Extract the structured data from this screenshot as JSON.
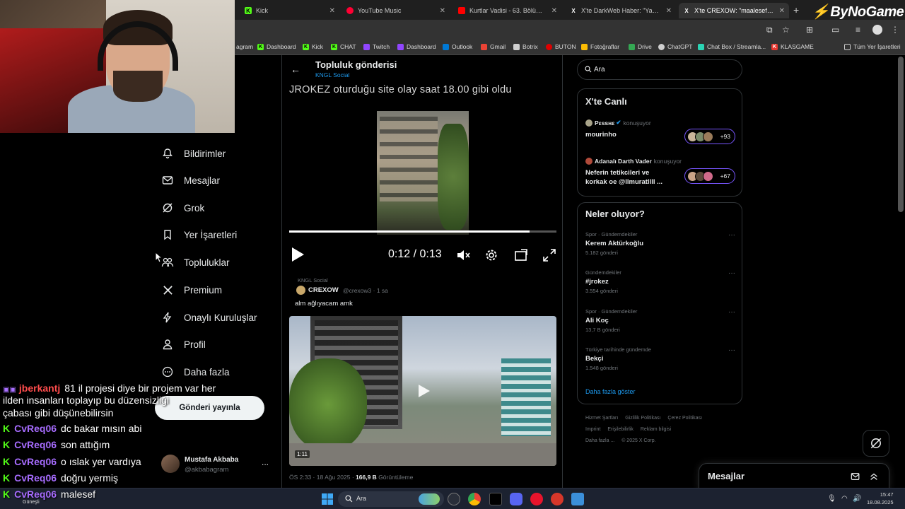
{
  "browser": {
    "tabs": [
      {
        "label": "Kick",
        "icon_color": "#53fc18",
        "icon_letter": "K",
        "active": false
      },
      {
        "label": "YouTube Music",
        "icon_color": "#ff0033",
        "icon_letter": "",
        "active": false
      },
      {
        "label": "Kurtlar Vadisi - 63. Bölüm FULL",
        "icon_color": "#ff0000",
        "icon_letter": "",
        "active": false
      },
      {
        "label": "X'te DarkWeb Haber: \"Yayıncı J",
        "icon_color": "#000000",
        "icon_letter": "X",
        "active": false
      },
      {
        "label": "X'te CREXOW: \"maalesef gerçe",
        "icon_color": "#000000",
        "icon_letter": "X",
        "active": true
      }
    ],
    "brand": "ByNoGame",
    "bookmarks": [
      {
        "label": "agram",
        "color": "#000"
      },
      {
        "label": "Dashboard",
        "color": "#53fc18",
        "letter": "K"
      },
      {
        "label": "Kick",
        "color": "#53fc18",
        "letter": "K"
      },
      {
        "label": "CHAT",
        "color": "#53fc18",
        "letter": "K"
      },
      {
        "label": "Twitch",
        "color": "#9146ff",
        "letter": ""
      },
      {
        "label": "Dashboard",
        "color": "#9146ff",
        "letter": ""
      },
      {
        "label": "Outlook",
        "color": "#0078d4",
        "letter": ""
      },
      {
        "label": "Gmail",
        "color": "#ea4335",
        "letter": ""
      },
      {
        "label": "Botrix",
        "color": "#cfcfcf",
        "letter": ""
      },
      {
        "label": "BUTON",
        "color": "#e00000",
        "letter": ""
      },
      {
        "label": "Fotoğraflar",
        "color": "#fbbc04",
        "letter": ""
      },
      {
        "label": "Drive",
        "color": "#34a853",
        "letter": ""
      },
      {
        "label": "ChatGPT",
        "color": "#cfcfcf",
        "letter": ""
      },
      {
        "label": "Chat Box / Streamla...",
        "color": "#2bd4b4",
        "letter": ""
      },
      {
        "label": "KLASGAME",
        "color": "#e8372f",
        "letter": "K"
      },
      {
        "label": "Tüm Yer İşaretleri",
        "color": "#cfcfcf",
        "letter": ""
      }
    ]
  },
  "nav": {
    "items": [
      {
        "label": "Bildirimler",
        "icon": "bell-icon"
      },
      {
        "label": "Mesajlar",
        "icon": "mail-icon"
      },
      {
        "label": "Grok",
        "icon": "grok-icon"
      },
      {
        "label": "Yer İşaretleri",
        "icon": "bookmark-icon"
      },
      {
        "label": "Topluluklar",
        "icon": "communities-icon"
      },
      {
        "label": "Premium",
        "icon": "x-logo-icon"
      },
      {
        "label": "Onaylı Kuruluşlar",
        "icon": "lightning-icon"
      },
      {
        "label": "Profil",
        "icon": "person-icon"
      },
      {
        "label": "Daha fazla",
        "icon": "more-circle-icon"
      }
    ],
    "post_button": "Gönderi yayınla",
    "profile": {
      "name": "Mustafa Akbaba",
      "handle": "@akbabagram",
      "more": "..."
    }
  },
  "chat": {
    "lines": [
      {
        "user": "jberkantj",
        "user_color": "#ff4d4d",
        "text": "81 il projesi diye bir projem var her",
        "badge": "twitch"
      },
      {
        "user": "",
        "user_color": "#fff",
        "text": "ilden insanları toplayıp bu düzensizliği",
        "badge": ""
      },
      {
        "user": "",
        "user_color": "#fff",
        "text": "çabası gibi düşünebilirsin",
        "badge": ""
      },
      {
        "user": "CvReq06",
        "user_color": "#a76cff",
        "text": "dc bakar mısın abi",
        "badge": "kick"
      },
      {
        "user": "CvReq06",
        "user_color": "#a76cff",
        "text": "son attığım",
        "badge": "kick"
      },
      {
        "user": "CvReq06",
        "user_color": "#a76cff",
        "text": "o ıslak yer vardıya",
        "badge": "kick"
      },
      {
        "user": "CvReq06",
        "user_color": "#a76cff",
        "text": "doğru yermiş",
        "badge": "kick"
      },
      {
        "user": "CvReq06",
        "user_color": "#a76cff",
        "text": "malesef",
        "badge": "kick"
      }
    ]
  },
  "main": {
    "back": "←",
    "title": "Topluluk gönderisi",
    "subtitle": "KNGL Social",
    "video1": {
      "caption": "JROKEZ oturduğu site olay saat 18.00 gibi oldu",
      "time": "0:12 / 0:13",
      "progress": 0.9
    },
    "post2": {
      "context": "KNGL Social",
      "name": "CREXOW",
      "handle": "@crexow3 · 1 sa",
      "text": "alm ağlıyacam amk",
      "duration": "1:11"
    },
    "meta_time": "ÖS 2:33 · 18 Ağu 2025 · ",
    "meta_views": "166,9 B",
    "meta_views_label": " Görüntüleme"
  },
  "right": {
    "search_placeholder": "Ara",
    "live_title": "X'te Canlı",
    "live": [
      {
        "host": "Pεssнε",
        "action": "konuşuyor",
        "topic": "mourinho",
        "count": "+93"
      },
      {
        "host": "Adanalı Darth Vader",
        "action": "konuşuyor",
        "topic": "Neferin tetikcileri ve korkak oe @llmuratllll ...",
        "count": "+67"
      }
    ],
    "trends_title": "Neler oluyor?",
    "trends": [
      {
        "category": "Spor · Gündemdekiler",
        "name": "Kerem Aktürkoğlu",
        "count": "5.182 gönderi"
      },
      {
        "category": "Gündemdekiler",
        "name": "#jrokez",
        "count": "3.554 gönderi"
      },
      {
        "category": "Spor · Gündemdekiler",
        "name": "Ali Koç",
        "count": "13,7 B gönderi"
      },
      {
        "category": "Türkiye tarihinde gündemde",
        "name": "Bekçi",
        "count": "1.548 gönderi"
      }
    ],
    "show_more": "Daha fazla göster",
    "footer": [
      "Hizmet Şartları",
      "Gizlilik Politikası",
      "Çerez Politikası",
      "Imprint",
      "Erişilebilirlik",
      "Reklam bilgisi",
      "Daha fazla ...",
      "© 2025 X Corp."
    ],
    "messages": "Mesajlar"
  },
  "taskbar": {
    "weather": "Güneşli",
    "search": "Ara",
    "time": "15:47",
    "date": "18.08.2025"
  }
}
